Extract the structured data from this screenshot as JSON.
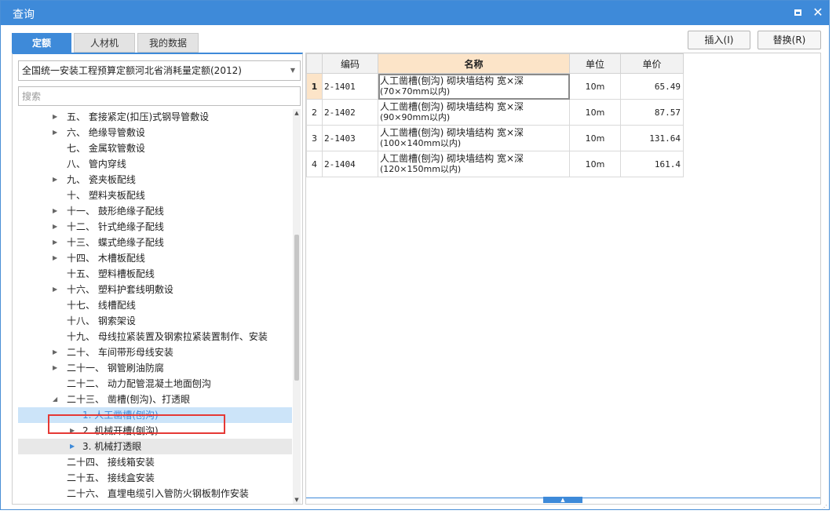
{
  "window": {
    "title": "查询"
  },
  "tabs": [
    {
      "label": "定额",
      "active": true
    },
    {
      "label": "人材机",
      "active": false
    },
    {
      "label": "我的数据",
      "active": false
    }
  ],
  "actions": {
    "insert_label": "插入(I)",
    "replace_label": "替换(R)"
  },
  "library": {
    "selected": "全国统一安装工程预算定额河北省消耗量定额(2012)"
  },
  "search": {
    "placeholder": "搜索",
    "value": ""
  },
  "tree": [
    {
      "text": "五、 套接紧定(扣压)式钢导管敷设",
      "level": 0,
      "expandable": true
    },
    {
      "text": "六、 绝缘导管敷设",
      "level": 0,
      "expandable": true
    },
    {
      "text": "七、 金属软管敷设",
      "level": 0,
      "expandable": false
    },
    {
      "text": "八、 管内穿线",
      "level": 0,
      "expandable": false
    },
    {
      "text": "九、 瓷夹板配线",
      "level": 0,
      "expandable": true
    },
    {
      "text": "十、 塑料夹板配线",
      "level": 0,
      "expandable": false
    },
    {
      "text": "十一、 鼓形绝缘子配线",
      "level": 0,
      "expandable": true
    },
    {
      "text": "十二、 针式绝缘子配线",
      "level": 0,
      "expandable": true
    },
    {
      "text": "十三、 蝶式绝缘子配线",
      "level": 0,
      "expandable": true
    },
    {
      "text": "十四、 木槽板配线",
      "level": 0,
      "expandable": true
    },
    {
      "text": "十五、 塑料槽板配线",
      "level": 0,
      "expandable": false
    },
    {
      "text": "十六、 塑料护套线明敷设",
      "level": 0,
      "expandable": true
    },
    {
      "text": "十七、 线槽配线",
      "level": 0,
      "expandable": false
    },
    {
      "text": "十八、 钢索架设",
      "level": 0,
      "expandable": false
    },
    {
      "text": "十九、 母线拉紧装置及钢索拉紧装置制作、安装",
      "level": 0,
      "expandable": false
    },
    {
      "text": "二十、 车间带形母线安装",
      "level": 0,
      "expandable": true
    },
    {
      "text": "二十一、 钢管刷油防腐",
      "level": 0,
      "expandable": true
    },
    {
      "text": "二十二、 动力配管混凝土地面刨沟",
      "level": 0,
      "expandable": false
    },
    {
      "text": "二十三、 凿槽(刨沟)、打透眼",
      "level": 0,
      "expandable": true,
      "expanded": true
    },
    {
      "text": "1. 人工凿槽(刨沟)",
      "level": 1,
      "expandable": false,
      "selected": true
    },
    {
      "text": "2. 机械开槽(刨沟)",
      "level": 1,
      "expandable": true
    },
    {
      "text": "3. 机械打透眼",
      "level": 1,
      "expandable": true,
      "hover": true
    },
    {
      "text": "二十四、 接线箱安装",
      "level": 0,
      "expandable": false
    },
    {
      "text": "二十五、 接线盒安装",
      "level": 0,
      "expandable": false
    },
    {
      "text": "二十六、 直埋电缆引入管防火钢板制作安装",
      "level": 0,
      "expandable": false
    }
  ],
  "grid": {
    "headers": {
      "code": "编码",
      "name": "名称",
      "unit": "单位",
      "price": "单价"
    },
    "rows": [
      {
        "num": "1",
        "code": "2-1401",
        "name": "人工凿槽(刨沟) 砌块墙结构 宽×深",
        "spec": "(70×70mm以内)",
        "unit": "10m",
        "price": "65.49"
      },
      {
        "num": "2",
        "code": "2-1402",
        "name": "人工凿槽(刨沟) 砌块墙结构 宽×深",
        "spec": "(90×90mm以内)",
        "unit": "10m",
        "price": "87.57"
      },
      {
        "num": "3",
        "code": "2-1403",
        "name": "人工凿槽(刨沟) 砌块墙结构 宽×深",
        "spec": "(100×140mm以内)",
        "unit": "10m",
        "price": "131.64"
      },
      {
        "num": "4",
        "code": "2-1404",
        "name": "人工凿槽(刨沟) 砌块墙结构 宽×深",
        "spec": "(120×150mm以内)",
        "unit": "10m",
        "price": "161.4"
      }
    ]
  },
  "colors": {
    "accent": "#3e8ad9",
    "header_highlight": "#fce4c8",
    "selection": "#cce4f9",
    "annotation_red": "#e53935"
  },
  "icons": {
    "maximize": "maximize-icon",
    "close": "close-icon",
    "expand": "triangle-right-icon",
    "collapse": "triangle-down-icon",
    "dropdown": "chevron-down-icon",
    "splitter": "triangle-up-icon"
  }
}
